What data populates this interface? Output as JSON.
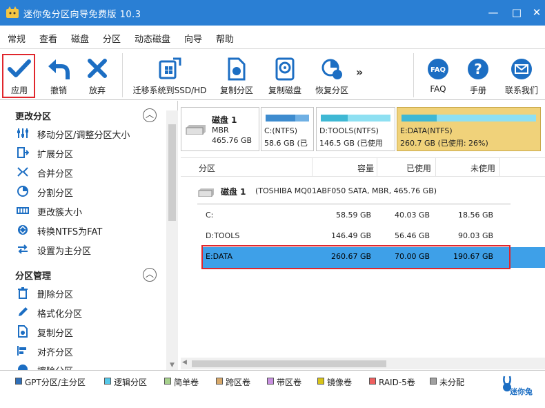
{
  "window": {
    "title": "迷你兔分区向导免费版 10.3",
    "app_icon": "rabbit-logo-icon",
    "minimize": "—",
    "maximize": "□",
    "close": "✕",
    "title_bg": "#2a7fd4"
  },
  "menu": [
    "常规",
    "查看",
    "磁盘",
    "分区",
    "动态磁盘",
    "向导",
    "帮助"
  ],
  "toolbar": {
    "apply": "应用",
    "undo": "撤销",
    "discard": "放弃",
    "migrate": "迁移系统到SSD/HD",
    "copy_partition": "复制分区",
    "copy_disk": "复制磁盘",
    "recover": "恢复分区",
    "more": "»",
    "faq": "FAQ",
    "manual": "手册",
    "contact": "联系我们"
  },
  "left_panel": {
    "change_section": {
      "title": "更改分区",
      "items": [
        "移动分区/调整分区大小",
        "扩展分区",
        "合并分区",
        "分割分区",
        "更改簇大小",
        "转换NTFS为FAT",
        "设置为主分区"
      ]
    },
    "manage_section": {
      "title": "分区管理",
      "items": [
        "删除分区",
        "格式化分区",
        "复制分区",
        "对齐分区",
        "擦除分区"
      ]
    }
  },
  "disk_map": {
    "disk_name": "磁盘  1",
    "disk_type": "MBR",
    "disk_size": "465.76 GB",
    "partitions": [
      {
        "label": "C:(NTFS)",
        "detail": "58.6 GB (已",
        "used_fraction": 0.69,
        "fill_color": "#3e8ccf",
        "selected": false
      },
      {
        "label": "D:TOOLS(NTFS)",
        "detail": "146.5 GB (已使用",
        "used_fraction": 0.39,
        "fill_color": "#3fb8d4",
        "selected": false
      },
      {
        "label": "E:DATA(NTFS)",
        "detail": "260.7 GB (已使用: 26%)",
        "used_fraction": 0.26,
        "fill_color": "#3fb8d4",
        "selected": true
      }
    ]
  },
  "table": {
    "headers": [
      "分区",
      "容量",
      "已使用",
      "未使用"
    ],
    "disk_row": {
      "name": "磁盘  1",
      "desc": "(TOSHIBA MQ01ABF050 SATA, MBR, 465.76 GB)"
    },
    "rows": [
      {
        "name": "C:",
        "capacity": "58.59 GB",
        "used": "40.03 GB",
        "unused": "18.56 GB",
        "selected": false
      },
      {
        "name": "D:TOOLS",
        "capacity": "146.49 GB",
        "used": "56.46 GB",
        "unused": "90.03 GB",
        "selected": false
      },
      {
        "name": "E:DATA",
        "capacity": "260.67 GB",
        "used": "70.00 GB",
        "unused": "190.67 GB",
        "selected": true
      }
    ]
  },
  "legend": [
    {
      "label": "GPT分区/主分区",
      "color": "#2f6fb8"
    },
    {
      "label": "逻辑分区",
      "color": "#56c8e8"
    },
    {
      "label": "简单卷",
      "color": "#a6d08c"
    },
    {
      "label": "跨区卷",
      "color": "#d8a96a"
    },
    {
      "label": "带区卷",
      "color": "#c890e0"
    },
    {
      "label": "镜像卷",
      "color": "#d8c418"
    },
    {
      "label": "RAID-5卷",
      "color": "#ee6060"
    },
    {
      "label": "未分配",
      "color": "#a0a0a0"
    }
  ],
  "brand": {
    "text": "迷你兔",
    "icon": "rabbit-brand-icon"
  },
  "colors": {
    "accent": "#2a7fd4",
    "selection": "#3ea0e8",
    "highlight_border": "#e0262c",
    "selected_block": "#f0d27a"
  }
}
